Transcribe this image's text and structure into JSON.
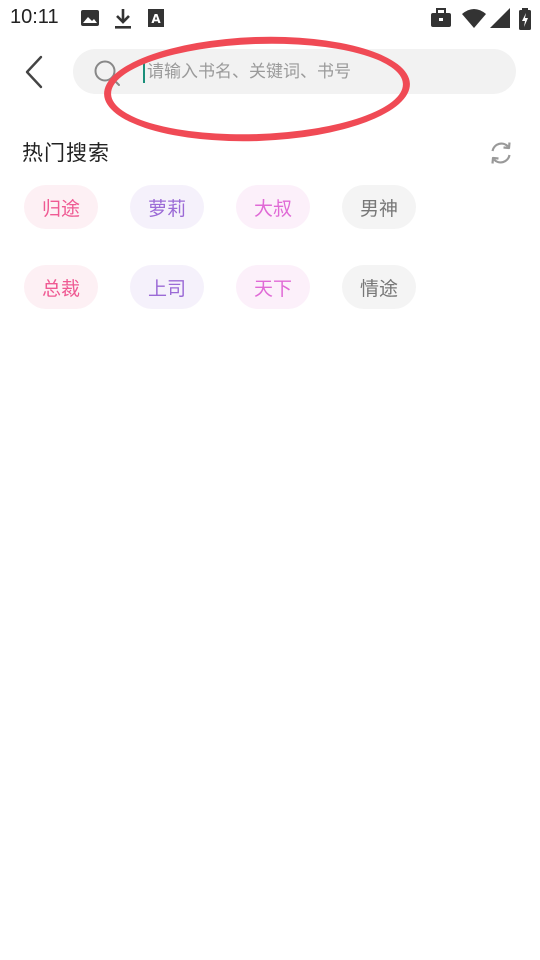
{
  "status_bar": {
    "time": "10:11",
    "icons": [
      "image-icon",
      "download-icon",
      "a-box-icon",
      "briefcase-icon",
      "wifi-icon",
      "signal-icon",
      "battery-icon"
    ]
  },
  "search": {
    "placeholder": "请输入书名、关键词、书号",
    "value": ""
  },
  "hot_search": {
    "title": "热门搜索",
    "tags": [
      {
        "label": "归途",
        "color": "#ef5a93",
        "bg": "#fdf0f4"
      },
      {
        "label": "萝莉",
        "color": "#9b6ad6",
        "bg": "#f5f1fb"
      },
      {
        "label": "大叔",
        "color": "#e06ad6",
        "bg": "#fcf0fa"
      },
      {
        "label": "男神",
        "color": "#777777",
        "bg": "#f4f4f4"
      },
      {
        "label": "总裁",
        "color": "#ef5a93",
        "bg": "#fdf0f4"
      },
      {
        "label": "上司",
        "color": "#9b6ad6",
        "bg": "#f5f1fb"
      },
      {
        "label": "天下",
        "color": "#e06ad6",
        "bg": "#fcf0fa"
      },
      {
        "label": "情途",
        "color": "#777777",
        "bg": "#f4f4f4"
      }
    ]
  },
  "colors": {
    "annotation_red": "#f04a55",
    "cursor": "#1a8f7a"
  }
}
